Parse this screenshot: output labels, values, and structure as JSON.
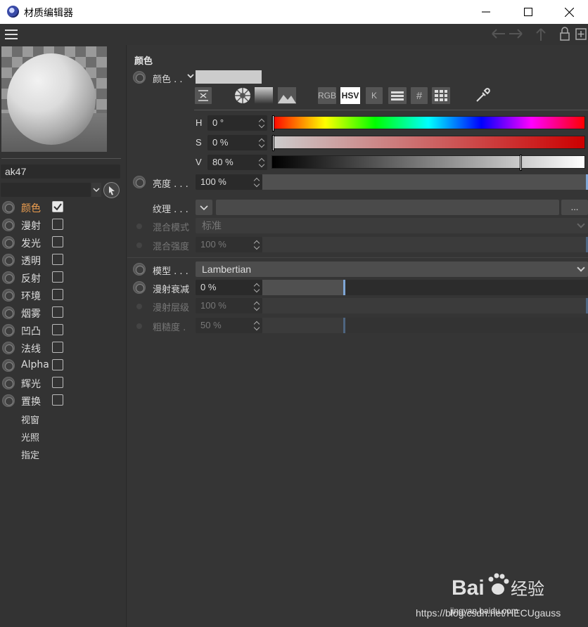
{
  "window": {
    "title": "材质编辑器",
    "controls": {
      "minimize": "minimize-icon",
      "maximize": "maximize-icon",
      "close": "close-icon"
    }
  },
  "toolbar": {
    "menu_icon": "hamburger-icon",
    "nav_icons": [
      "back-arrow-icon",
      "forward-arrow-icon",
      "up-arrow-icon",
      "lock-icon",
      "new-window-icon"
    ]
  },
  "material": {
    "name": "ak47",
    "preview_icon": "sphere-preview"
  },
  "channels": [
    {
      "label": "颜色",
      "checked": true,
      "active": true
    },
    {
      "label": "漫射",
      "checked": false
    },
    {
      "label": "发光",
      "checked": false
    },
    {
      "label": "透明",
      "checked": false
    },
    {
      "label": "反射",
      "checked": false
    },
    {
      "label": "环境",
      "checked": false
    },
    {
      "label": "烟雾",
      "checked": false
    },
    {
      "label": "凹凸",
      "checked": false
    },
    {
      "label": "法线",
      "checked": false
    },
    {
      "label": "Alpha",
      "checked": false
    },
    {
      "label": "辉光",
      "checked": false
    },
    {
      "label": "置换",
      "checked": false
    }
  ],
  "extra_items": [
    "视窗",
    "光照",
    "指定"
  ],
  "color_section": {
    "title": "颜色",
    "color_label": "颜色 . .",
    "swatch_color": "#cccccc",
    "picker_modes": [
      "RGB",
      "HSV",
      "K",
      "#"
    ],
    "active_mode": "HSV",
    "h_label": "H",
    "h_value": "0 °",
    "h_fraction": 0.0,
    "s_label": "S",
    "s_value": "0 %",
    "s_fraction": 0.0,
    "v_label": "V",
    "v_value": "80 %",
    "v_fraction": 0.8
  },
  "brightness": {
    "label": "亮度 . . .",
    "value": "100 %",
    "fraction": 1.0
  },
  "texture": {
    "label": "纹理 . . .",
    "more": "..."
  },
  "blend_mode": {
    "label": "混合模式",
    "value": "标准"
  },
  "blend_strength": {
    "label": "混合强度",
    "value": "100 %",
    "fraction": 1.0
  },
  "model": {
    "label": "模型 . . .",
    "value": "Lambertian"
  },
  "diffuse_falloff": {
    "label": "漫射衰减",
    "value": "0 %",
    "fraction": 0.5
  },
  "diffuse_level": {
    "label": "漫射层级",
    "value": "100 %",
    "fraction": 1.0
  },
  "roughness": {
    "label": "粗糙度 .",
    "value": "50 %",
    "fraction": 0.5
  },
  "watermark": {
    "brand": "Bai 经验",
    "site": "jingyan.baidu.com",
    "url": "https://blog.csdn.net/HECUgauss"
  }
}
